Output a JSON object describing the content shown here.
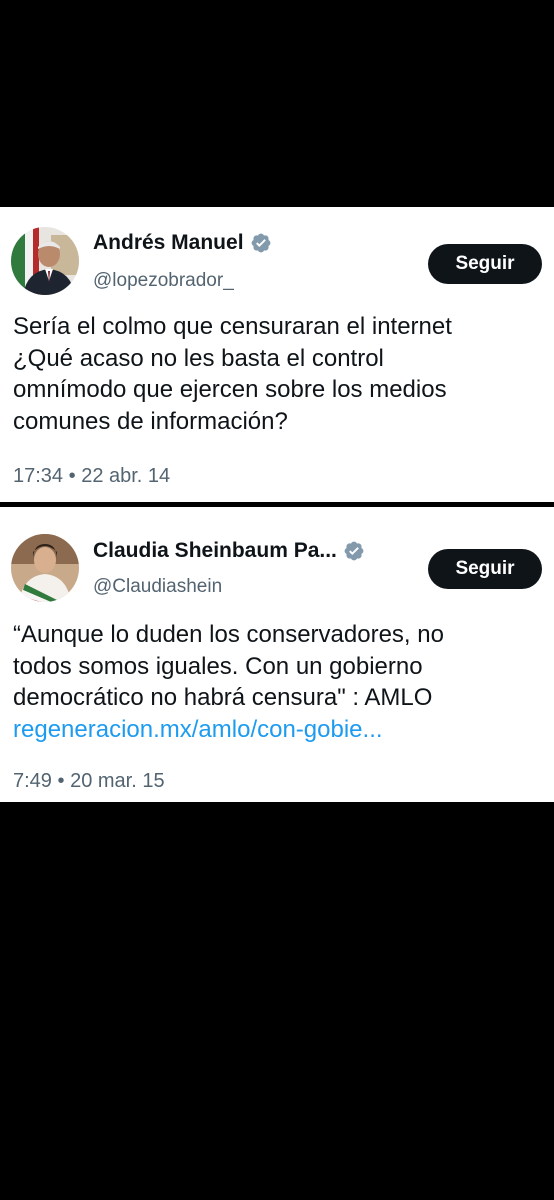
{
  "tweets": [
    {
      "display_name": "Andrés Manuel",
      "handle": "@lopezobrador_",
      "follow_label": "Seguir",
      "text_lines": [
        "Sería el colmo que censuraran el internet",
        "¿Qué acaso no les basta el control",
        "omnímodo que ejercen sobre los medios",
        "comunes de información?"
      ],
      "time": "17:34",
      "separator": "•",
      "date": "22 abr. 14"
    },
    {
      "display_name": "Claudia Sheinbaum Pa...",
      "handle": "@Claudiashein",
      "follow_label": "Seguir",
      "text_lines": [
        "“Aunque lo duden los conservadores, no",
        "todos somos iguales. Con un gobierno",
        "democrático no habrá censura\" : AMLO"
      ],
      "link": "regeneracion.mx/amlo/con-gobie...",
      "time": "7:49",
      "separator": "•",
      "date": "20 mar. 15"
    }
  ],
  "icons": {
    "verified": "verified-badge-icon",
    "avatar": "profile-photo"
  },
  "colors": {
    "background": "#000000",
    "card": "#ffffff",
    "text": "#0f1419",
    "secondary": "#536471",
    "link": "#1d9bf0",
    "verified_badge": "#829aab",
    "button": "#0f1419"
  }
}
